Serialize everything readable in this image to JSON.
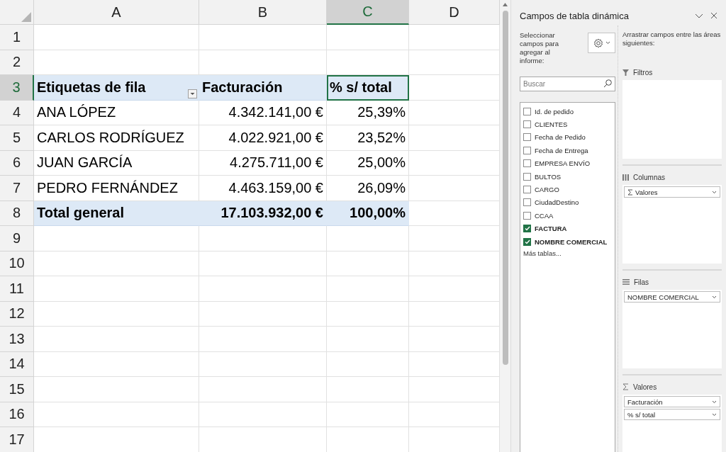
{
  "sheet": {
    "columns": [
      {
        "label": "A",
        "selected": false
      },
      {
        "label": "B",
        "selected": false
      },
      {
        "label": "C",
        "selected": true
      },
      {
        "label": "D",
        "selected": false
      }
    ],
    "rows": [
      {
        "number": "1",
        "selected": false,
        "kind": "blank",
        "cells": []
      },
      {
        "number": "2",
        "selected": false,
        "kind": "blank",
        "cells": []
      },
      {
        "number": "3",
        "selected": true,
        "kind": "header",
        "cells": [
          {
            "text": "Etiquetas de fila",
            "selected": false
          },
          {
            "text": "Facturación",
            "selected": false
          },
          {
            "text": "% s/ total",
            "selected": true
          }
        ]
      },
      {
        "number": "4",
        "selected": false,
        "kind": "data",
        "cells": [
          {
            "text": "ANA LÓPEZ",
            "selected": false
          },
          {
            "text": "4.342.141,00 €",
            "selected": false
          },
          {
            "text": "25,39%",
            "selected": false
          }
        ]
      },
      {
        "number": "5",
        "selected": false,
        "kind": "data",
        "cells": [
          {
            "text": "CARLOS RODRÍGUEZ",
            "selected": false
          },
          {
            "text": "4.022.921,00 €",
            "selected": false
          },
          {
            "text": "23,52%",
            "selected": false
          }
        ]
      },
      {
        "number": "6",
        "selected": false,
        "kind": "data",
        "cells": [
          {
            "text": "JUAN GARCÍA",
            "selected": false
          },
          {
            "text": "4.275.711,00 €",
            "selected": false
          },
          {
            "text": "25,00%",
            "selected": false
          }
        ]
      },
      {
        "number": "7",
        "selected": false,
        "kind": "data",
        "cells": [
          {
            "text": "PEDRO FERNÁNDEZ",
            "selected": false
          },
          {
            "text": "4.463.159,00 €",
            "selected": false
          },
          {
            "text": "26,09%",
            "selected": false
          }
        ]
      },
      {
        "number": "8",
        "selected": false,
        "kind": "total",
        "cells": [
          {
            "text": "Total general",
            "selected": false
          },
          {
            "text": "17.103.932,00 €",
            "selected": false
          },
          {
            "text": "100,00%",
            "selected": false
          }
        ]
      },
      {
        "number": "9",
        "selected": false,
        "kind": "blank",
        "cells": []
      },
      {
        "number": "10",
        "selected": false,
        "kind": "blank",
        "cells": []
      },
      {
        "number": "11",
        "selected": false,
        "kind": "blank",
        "cells": []
      },
      {
        "number": "12",
        "selected": false,
        "kind": "blank",
        "cells": []
      },
      {
        "number": "13",
        "selected": false,
        "kind": "blank",
        "cells": []
      },
      {
        "number": "14",
        "selected": false,
        "kind": "blank",
        "cells": []
      },
      {
        "number": "15",
        "selected": false,
        "kind": "blank",
        "cells": []
      },
      {
        "number": "16",
        "selected": false,
        "kind": "blank",
        "cells": []
      },
      {
        "number": "17",
        "selected": false,
        "kind": "blank",
        "cells": []
      }
    ]
  },
  "panel": {
    "title": "Campos de tabla dinámica",
    "select_label": "Seleccionar campos para agregar al informe:",
    "search": {
      "placeholder": "Buscar"
    },
    "fields": [
      {
        "label": "Id. de pedido",
        "checked": false
      },
      {
        "label": "CLIENTES",
        "checked": false
      },
      {
        "label": "Fecha de Pedido",
        "checked": false
      },
      {
        "label": "Fecha de Entrega",
        "checked": false
      },
      {
        "label": "EMPRESA ENVÍO",
        "checked": false
      },
      {
        "label": "BULTOS",
        "checked": false
      },
      {
        "label": "CARGO",
        "checked": false
      },
      {
        "label": "CiudadDestino",
        "checked": false
      },
      {
        "label": "CCAA",
        "checked": false
      },
      {
        "label": "FACTURA",
        "checked": true
      },
      {
        "label": "NOMBRE COMERCIAL",
        "checked": true
      }
    ],
    "more_tables": "Más tablas...",
    "drag_label": "Arrastrar campos entre las áreas siguientes:",
    "areas": [
      {
        "kind": "filters",
        "title": "Filtros"
      },
      {
        "kind": "columns",
        "title": "Columnas",
        "items": [
          {
            "label": "Valores",
            "kind": "values"
          }
        ]
      },
      {
        "kind": "rows",
        "title": "Filas",
        "items": [
          {
            "label": "NOMBRE COMERCIAL",
            "kind": "field"
          }
        ]
      },
      {
        "kind": "values",
        "title": "Valores",
        "items": [
          {
            "label": "Facturación",
            "kind": "field"
          },
          {
            "label": "% s/ total",
            "kind": "field"
          }
        ]
      }
    ]
  }
}
